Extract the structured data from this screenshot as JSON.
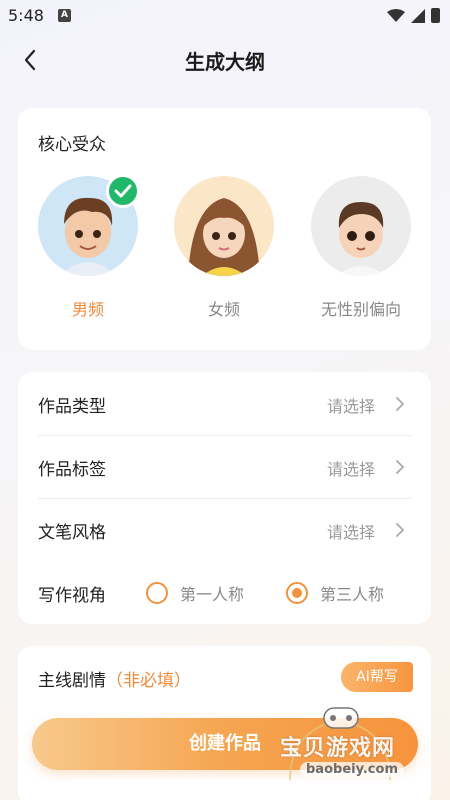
{
  "status": {
    "time": "5:48",
    "app_glyph": "A"
  },
  "header": {
    "title": "生成大纲"
  },
  "audience": {
    "title": "核心受众",
    "options": [
      {
        "label": "男频",
        "selected": true
      },
      {
        "label": "女频",
        "selected": false
      },
      {
        "label": "无性别偏向",
        "selected": false
      }
    ]
  },
  "form": {
    "rows": [
      {
        "label": "作品类型",
        "value": "请选择"
      },
      {
        "label": "作品标签",
        "value": "请选择"
      },
      {
        "label": "文笔风格",
        "value": "请选择"
      }
    ],
    "perspective": {
      "label": "写作视角",
      "options": [
        {
          "label": "第一人称",
          "selected": false
        },
        {
          "label": "第三人称",
          "selected": true
        }
      ]
    }
  },
  "plot": {
    "title": "主线剧情",
    "optional": "（非必填）",
    "ai_button": "AI帮写"
  },
  "create_button": "创建作品",
  "watermark": {
    "text": "宝贝游戏网",
    "url": "baobeiy.com"
  },
  "colors": {
    "accent": "#f08a3a",
    "check": "#20b86b",
    "muted": "#9a9a9a"
  }
}
